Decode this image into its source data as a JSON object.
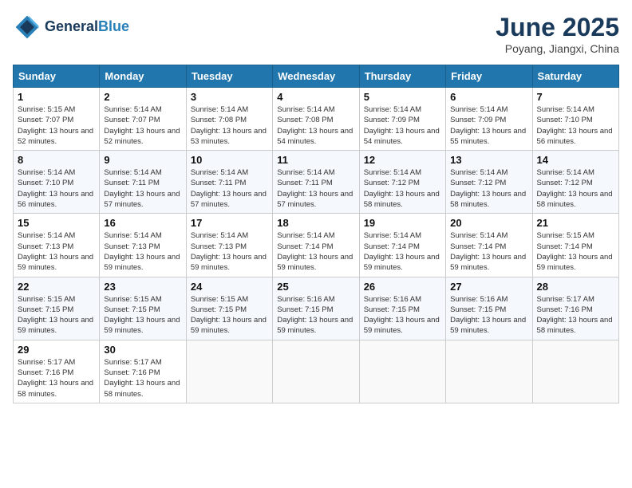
{
  "logo": {
    "line1": "General",
    "line2": "Blue"
  },
  "title": "June 2025",
  "subtitle": "Poyang, Jiangxi, China",
  "weekdays": [
    "Sunday",
    "Monday",
    "Tuesday",
    "Wednesday",
    "Thursday",
    "Friday",
    "Saturday"
  ],
  "weeks": [
    [
      {
        "day": "1",
        "sunrise": "5:15 AM",
        "sunset": "7:07 PM",
        "daylight": "13 hours and 52 minutes."
      },
      {
        "day": "2",
        "sunrise": "5:14 AM",
        "sunset": "7:07 PM",
        "daylight": "13 hours and 52 minutes."
      },
      {
        "day": "3",
        "sunrise": "5:14 AM",
        "sunset": "7:08 PM",
        "daylight": "13 hours and 53 minutes."
      },
      {
        "day": "4",
        "sunrise": "5:14 AM",
        "sunset": "7:08 PM",
        "daylight": "13 hours and 54 minutes."
      },
      {
        "day": "5",
        "sunrise": "5:14 AM",
        "sunset": "7:09 PM",
        "daylight": "13 hours and 54 minutes."
      },
      {
        "day": "6",
        "sunrise": "5:14 AM",
        "sunset": "7:09 PM",
        "daylight": "13 hours and 55 minutes."
      },
      {
        "day": "7",
        "sunrise": "5:14 AM",
        "sunset": "7:10 PM",
        "daylight": "13 hours and 56 minutes."
      }
    ],
    [
      {
        "day": "8",
        "sunrise": "5:14 AM",
        "sunset": "7:10 PM",
        "daylight": "13 hours and 56 minutes."
      },
      {
        "day": "9",
        "sunrise": "5:14 AM",
        "sunset": "7:11 PM",
        "daylight": "13 hours and 57 minutes."
      },
      {
        "day": "10",
        "sunrise": "5:14 AM",
        "sunset": "7:11 PM",
        "daylight": "13 hours and 57 minutes."
      },
      {
        "day": "11",
        "sunrise": "5:14 AM",
        "sunset": "7:11 PM",
        "daylight": "13 hours and 57 minutes."
      },
      {
        "day": "12",
        "sunrise": "5:14 AM",
        "sunset": "7:12 PM",
        "daylight": "13 hours and 58 minutes."
      },
      {
        "day": "13",
        "sunrise": "5:14 AM",
        "sunset": "7:12 PM",
        "daylight": "13 hours and 58 minutes."
      },
      {
        "day": "14",
        "sunrise": "5:14 AM",
        "sunset": "7:12 PM",
        "daylight": "13 hours and 58 minutes."
      }
    ],
    [
      {
        "day": "15",
        "sunrise": "5:14 AM",
        "sunset": "7:13 PM",
        "daylight": "13 hours and 59 minutes."
      },
      {
        "day": "16",
        "sunrise": "5:14 AM",
        "sunset": "7:13 PM",
        "daylight": "13 hours and 59 minutes."
      },
      {
        "day": "17",
        "sunrise": "5:14 AM",
        "sunset": "7:13 PM",
        "daylight": "13 hours and 59 minutes."
      },
      {
        "day": "18",
        "sunrise": "5:14 AM",
        "sunset": "7:14 PM",
        "daylight": "13 hours and 59 minutes."
      },
      {
        "day": "19",
        "sunrise": "5:14 AM",
        "sunset": "7:14 PM",
        "daylight": "13 hours and 59 minutes."
      },
      {
        "day": "20",
        "sunrise": "5:14 AM",
        "sunset": "7:14 PM",
        "daylight": "13 hours and 59 minutes."
      },
      {
        "day": "21",
        "sunrise": "5:15 AM",
        "sunset": "7:14 PM",
        "daylight": "13 hours and 59 minutes."
      }
    ],
    [
      {
        "day": "22",
        "sunrise": "5:15 AM",
        "sunset": "7:15 PM",
        "daylight": "13 hours and 59 minutes."
      },
      {
        "day": "23",
        "sunrise": "5:15 AM",
        "sunset": "7:15 PM",
        "daylight": "13 hours and 59 minutes."
      },
      {
        "day": "24",
        "sunrise": "5:15 AM",
        "sunset": "7:15 PM",
        "daylight": "13 hours and 59 minutes."
      },
      {
        "day": "25",
        "sunrise": "5:16 AM",
        "sunset": "7:15 PM",
        "daylight": "13 hours and 59 minutes."
      },
      {
        "day": "26",
        "sunrise": "5:16 AM",
        "sunset": "7:15 PM",
        "daylight": "13 hours and 59 minutes."
      },
      {
        "day": "27",
        "sunrise": "5:16 AM",
        "sunset": "7:15 PM",
        "daylight": "13 hours and 59 minutes."
      },
      {
        "day": "28",
        "sunrise": "5:17 AM",
        "sunset": "7:16 PM",
        "daylight": "13 hours and 58 minutes."
      }
    ],
    [
      {
        "day": "29",
        "sunrise": "5:17 AM",
        "sunset": "7:16 PM",
        "daylight": "13 hours and 58 minutes."
      },
      {
        "day": "30",
        "sunrise": "5:17 AM",
        "sunset": "7:16 PM",
        "daylight": "13 hours and 58 minutes."
      },
      null,
      null,
      null,
      null,
      null
    ]
  ]
}
